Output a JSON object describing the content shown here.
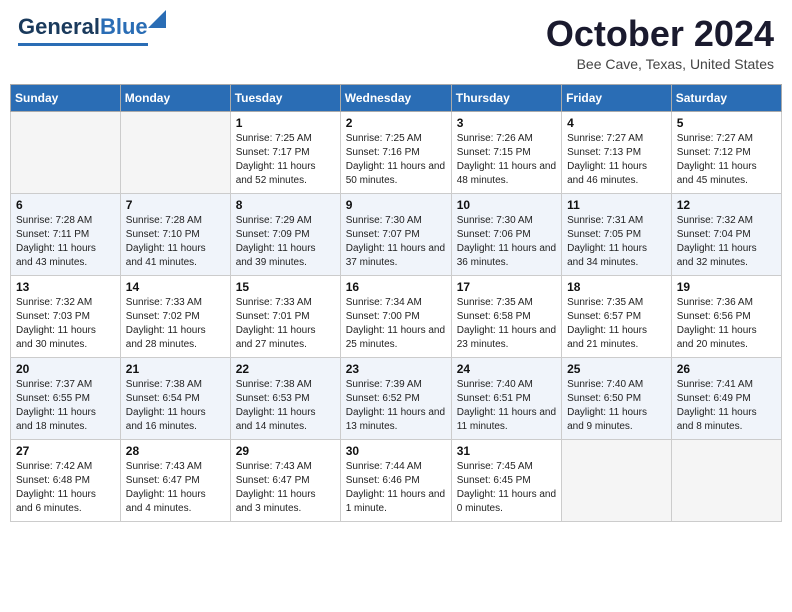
{
  "header": {
    "logo_general": "General",
    "logo_blue": "Blue",
    "month_title": "October 2024",
    "location": "Bee Cave, Texas, United States"
  },
  "days_of_week": [
    "Sunday",
    "Monday",
    "Tuesday",
    "Wednesday",
    "Thursday",
    "Friday",
    "Saturday"
  ],
  "weeks": [
    [
      {
        "day": "",
        "sunrise": "",
        "sunset": "",
        "daylight": "",
        "empty": true
      },
      {
        "day": "",
        "sunrise": "",
        "sunset": "",
        "daylight": "",
        "empty": true
      },
      {
        "day": "1",
        "sunrise": "Sunrise: 7:25 AM",
        "sunset": "Sunset: 7:17 PM",
        "daylight": "Daylight: 11 hours and 52 minutes.",
        "empty": false
      },
      {
        "day": "2",
        "sunrise": "Sunrise: 7:25 AM",
        "sunset": "Sunset: 7:16 PM",
        "daylight": "Daylight: 11 hours and 50 minutes.",
        "empty": false
      },
      {
        "day": "3",
        "sunrise": "Sunrise: 7:26 AM",
        "sunset": "Sunset: 7:15 PM",
        "daylight": "Daylight: 11 hours and 48 minutes.",
        "empty": false
      },
      {
        "day": "4",
        "sunrise": "Sunrise: 7:27 AM",
        "sunset": "Sunset: 7:13 PM",
        "daylight": "Daylight: 11 hours and 46 minutes.",
        "empty": false
      },
      {
        "day": "5",
        "sunrise": "Sunrise: 7:27 AM",
        "sunset": "Sunset: 7:12 PM",
        "daylight": "Daylight: 11 hours and 45 minutes.",
        "empty": false
      }
    ],
    [
      {
        "day": "6",
        "sunrise": "Sunrise: 7:28 AM",
        "sunset": "Sunset: 7:11 PM",
        "daylight": "Daylight: 11 hours and 43 minutes.",
        "empty": false
      },
      {
        "day": "7",
        "sunrise": "Sunrise: 7:28 AM",
        "sunset": "Sunset: 7:10 PM",
        "daylight": "Daylight: 11 hours and 41 minutes.",
        "empty": false
      },
      {
        "day": "8",
        "sunrise": "Sunrise: 7:29 AM",
        "sunset": "Sunset: 7:09 PM",
        "daylight": "Daylight: 11 hours and 39 minutes.",
        "empty": false
      },
      {
        "day": "9",
        "sunrise": "Sunrise: 7:30 AM",
        "sunset": "Sunset: 7:07 PM",
        "daylight": "Daylight: 11 hours and 37 minutes.",
        "empty": false
      },
      {
        "day": "10",
        "sunrise": "Sunrise: 7:30 AM",
        "sunset": "Sunset: 7:06 PM",
        "daylight": "Daylight: 11 hours and 36 minutes.",
        "empty": false
      },
      {
        "day": "11",
        "sunrise": "Sunrise: 7:31 AM",
        "sunset": "Sunset: 7:05 PM",
        "daylight": "Daylight: 11 hours and 34 minutes.",
        "empty": false
      },
      {
        "day": "12",
        "sunrise": "Sunrise: 7:32 AM",
        "sunset": "Sunset: 7:04 PM",
        "daylight": "Daylight: 11 hours and 32 minutes.",
        "empty": false
      }
    ],
    [
      {
        "day": "13",
        "sunrise": "Sunrise: 7:32 AM",
        "sunset": "Sunset: 7:03 PM",
        "daylight": "Daylight: 11 hours and 30 minutes.",
        "empty": false
      },
      {
        "day": "14",
        "sunrise": "Sunrise: 7:33 AM",
        "sunset": "Sunset: 7:02 PM",
        "daylight": "Daylight: 11 hours and 28 minutes.",
        "empty": false
      },
      {
        "day": "15",
        "sunrise": "Sunrise: 7:33 AM",
        "sunset": "Sunset: 7:01 PM",
        "daylight": "Daylight: 11 hours and 27 minutes.",
        "empty": false
      },
      {
        "day": "16",
        "sunrise": "Sunrise: 7:34 AM",
        "sunset": "Sunset: 7:00 PM",
        "daylight": "Daylight: 11 hours and 25 minutes.",
        "empty": false
      },
      {
        "day": "17",
        "sunrise": "Sunrise: 7:35 AM",
        "sunset": "Sunset: 6:58 PM",
        "daylight": "Daylight: 11 hours and 23 minutes.",
        "empty": false
      },
      {
        "day": "18",
        "sunrise": "Sunrise: 7:35 AM",
        "sunset": "Sunset: 6:57 PM",
        "daylight": "Daylight: 11 hours and 21 minutes.",
        "empty": false
      },
      {
        "day": "19",
        "sunrise": "Sunrise: 7:36 AM",
        "sunset": "Sunset: 6:56 PM",
        "daylight": "Daylight: 11 hours and 20 minutes.",
        "empty": false
      }
    ],
    [
      {
        "day": "20",
        "sunrise": "Sunrise: 7:37 AM",
        "sunset": "Sunset: 6:55 PM",
        "daylight": "Daylight: 11 hours and 18 minutes.",
        "empty": false
      },
      {
        "day": "21",
        "sunrise": "Sunrise: 7:38 AM",
        "sunset": "Sunset: 6:54 PM",
        "daylight": "Daylight: 11 hours and 16 minutes.",
        "empty": false
      },
      {
        "day": "22",
        "sunrise": "Sunrise: 7:38 AM",
        "sunset": "Sunset: 6:53 PM",
        "daylight": "Daylight: 11 hours and 14 minutes.",
        "empty": false
      },
      {
        "day": "23",
        "sunrise": "Sunrise: 7:39 AM",
        "sunset": "Sunset: 6:52 PM",
        "daylight": "Daylight: 11 hours and 13 minutes.",
        "empty": false
      },
      {
        "day": "24",
        "sunrise": "Sunrise: 7:40 AM",
        "sunset": "Sunset: 6:51 PM",
        "daylight": "Daylight: 11 hours and 11 minutes.",
        "empty": false
      },
      {
        "day": "25",
        "sunrise": "Sunrise: 7:40 AM",
        "sunset": "Sunset: 6:50 PM",
        "daylight": "Daylight: 11 hours and 9 minutes.",
        "empty": false
      },
      {
        "day": "26",
        "sunrise": "Sunrise: 7:41 AM",
        "sunset": "Sunset: 6:49 PM",
        "daylight": "Daylight: 11 hours and 8 minutes.",
        "empty": false
      }
    ],
    [
      {
        "day": "27",
        "sunrise": "Sunrise: 7:42 AM",
        "sunset": "Sunset: 6:48 PM",
        "daylight": "Daylight: 11 hours and 6 minutes.",
        "empty": false
      },
      {
        "day": "28",
        "sunrise": "Sunrise: 7:43 AM",
        "sunset": "Sunset: 6:47 PM",
        "daylight": "Daylight: 11 hours and 4 minutes.",
        "empty": false
      },
      {
        "day": "29",
        "sunrise": "Sunrise: 7:43 AM",
        "sunset": "Sunset: 6:47 PM",
        "daylight": "Daylight: 11 hours and 3 minutes.",
        "empty": false
      },
      {
        "day": "30",
        "sunrise": "Sunrise: 7:44 AM",
        "sunset": "Sunset: 6:46 PM",
        "daylight": "Daylight: 11 hours and 1 minute.",
        "empty": false
      },
      {
        "day": "31",
        "sunrise": "Sunrise: 7:45 AM",
        "sunset": "Sunset: 6:45 PM",
        "daylight": "Daylight: 11 hours and 0 minutes.",
        "empty": false
      },
      {
        "day": "",
        "sunrise": "",
        "sunset": "",
        "daylight": "",
        "empty": true
      },
      {
        "day": "",
        "sunrise": "",
        "sunset": "",
        "daylight": "",
        "empty": true
      }
    ]
  ]
}
